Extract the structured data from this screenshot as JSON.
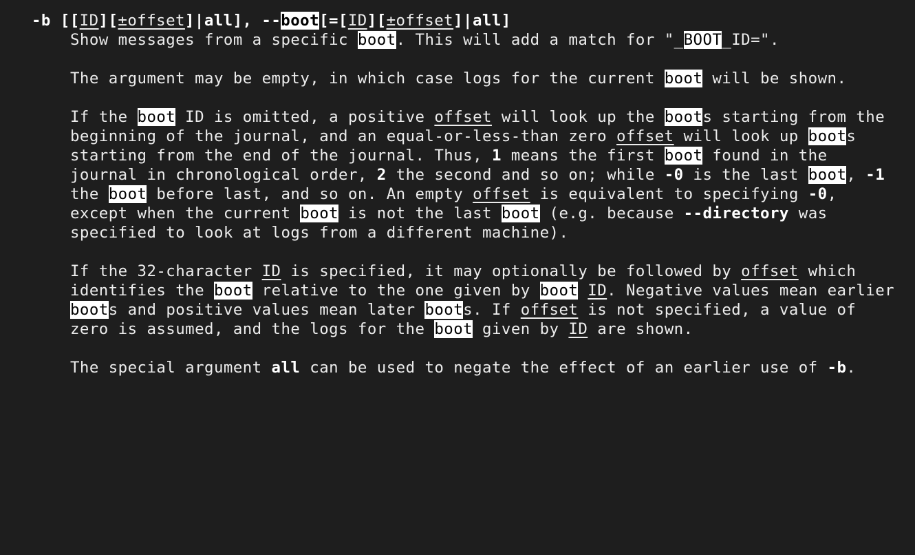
{
  "option_header": {
    "p1": "-b",
    "p2": " [[",
    "p3": "ID",
    "p4": "][",
    "p5": "±offset",
    "p6": "]|",
    "p7": "all",
    "p8": "], ",
    "p9": "--",
    "p10": "boot",
    "p11": "[=[",
    "p12": "ID",
    "p13": "][",
    "p14": "±offset",
    "p15": "]|",
    "p16": "all",
    "p17": "]"
  },
  "lines": {
    "l1": {
      "t1": "Show messages from a specific ",
      "h1": "boot",
      "t2": ". This will add a match for \"_",
      "h2": "BOOT",
      "t3": "_ID=\"."
    },
    "l2": {
      "t1": "The argument may be empty, in which case logs for the current ",
      "h1": "boot",
      "t2": " will be shown."
    },
    "l3": {
      "t1": "If the ",
      "h1": "boot",
      "t2": " ID is omitted, a positive ",
      "u1": "offset",
      "t3": " will look up the ",
      "h2": "boot",
      "t4": "s starting from the"
    },
    "l4": {
      "t1": "beginning of the journal, and an equal-or-less-than zero ",
      "u1": "offset",
      "t2": " will look up ",
      "h1": "boot",
      "t3": "s"
    },
    "l5": {
      "t1": "starting from the end of the journal. Thus, ",
      "b1": "1",
      "t2": " means the first ",
      "h1": "boot",
      "t3": " found in the"
    },
    "l6": {
      "t1": "journal in chronological order, ",
      "b1": "2",
      "t2": " the second and so on; while ",
      "b2": "-0",
      "t3": " is the last ",
      "h1": "boot",
      "t4": ", ",
      "b3": "-1"
    },
    "l7": {
      "t1": "the ",
      "h1": "boot",
      "t2": " before last, and so on. An empty ",
      "u1": "offset",
      "t3": " is equivalent to specifying ",
      "b1": "-0",
      "t4": ","
    },
    "l8": {
      "t1": "except when the current ",
      "h1": "boot",
      "t2": " is not the last ",
      "h2": "boot",
      "t3": " (e.g. because ",
      "b1": "--directory",
      "t4": " was"
    },
    "l9": {
      "t1": "specified to look at logs from a different machine)."
    },
    "l10": {
      "t1": "If the 32-character ",
      "u1": "ID",
      "t2": " is specified, it may optionally be followed by ",
      "u2": "offset",
      "t3": " which"
    },
    "l11": {
      "t1": "identifies the ",
      "h1": "boot",
      "t2": " relative to the one given by ",
      "h2": "boot",
      "t3": " ",
      "u1": "ID",
      "t4": ". Negative values mean earlier"
    },
    "l12": {
      "h1": "boot",
      "t1": "s and positive values mean later ",
      "h2": "boot",
      "t2": "s. If ",
      "u1": "offset",
      "t3": " is not specified, a value of"
    },
    "l13": {
      "t1": "zero is assumed, and the logs for the ",
      "h1": "boot",
      "t2": " given by ",
      "u1": "ID",
      "t3": " are shown."
    },
    "l14": {
      "t1": "The special argument ",
      "b1": "all",
      "t2": " can be used to negate the effect of an earlier use of ",
      "b2": "-b",
      "t3": "."
    }
  }
}
